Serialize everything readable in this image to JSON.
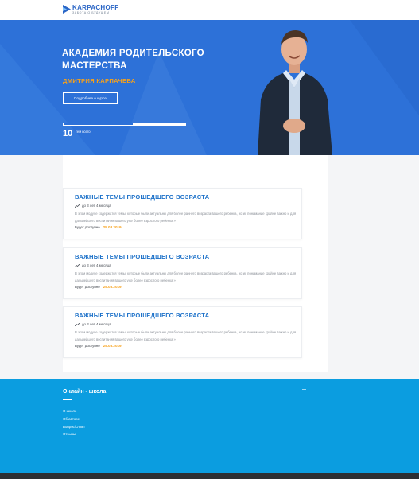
{
  "header": {
    "logo_name": "KARPACHOFF",
    "logo_sub": "ЗАБОТА О БУДУЩЕМ"
  },
  "hero": {
    "title": "Академия родительского мастерства",
    "author": "Дмитрия Карпачева",
    "button_label": "Подробнее о курсе",
    "progress": 0.57,
    "count": "10",
    "count_label": "тем всего"
  },
  "modules": [
    {
      "title": "Важные темы прошедшего возраста",
      "age": "до 3 лет 4 месяца",
      "description": "В этом модуле содержатся темы, которые были актуальны для более раннего возраста вашего ребенка, но их понимание крайне важно и для дальнейшего воспитания вашего уже более взрослого ребенка »",
      "available_label": "Будет доступно",
      "available_date": "25.03.2019"
    },
    {
      "title": "Важные темы прошедшего возраста",
      "age": "до 3 лет 4 месяца",
      "description": "В этом модуле содержатся темы, которые были актуальны для более раннего возраста вашего ребенка, но их понимание крайне важно и для дальнейшего воспитания вашего уже более взрослого ребенка »",
      "available_label": "Будет доступно",
      "available_date": "25.03.2019"
    },
    {
      "title": "Важные темы прошедшего возраста",
      "age": "до 3 лет 4 месяца",
      "description": "В этом модуле содержатся темы, которые были актуальны для более раннего возраста вашего ребенка, но их понимание крайне важно и для дальнейшего воспитания вашего уже более взрослого ребенка »",
      "available_label": "Будет доступно",
      "available_date": "25.03.2019"
    }
  ],
  "footer": {
    "title": "Онлайн - школа",
    "menu": [
      "О школе",
      "Об авторе",
      "Вопрос/Ответ",
      "Отзывы"
    ]
  },
  "colors": {
    "hero_blue": "#2d71d8",
    "accent_orange": "#f7a11a",
    "title_blue": "#1e72c9",
    "footer_blue": "#0b9de0"
  }
}
